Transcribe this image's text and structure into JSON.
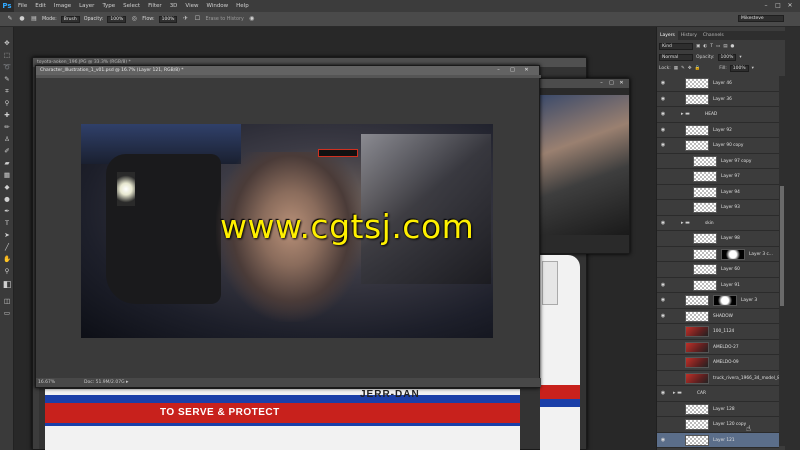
{
  "app": {
    "logo": "Ps"
  },
  "menu": [
    "File",
    "Edit",
    "Image",
    "Layer",
    "Type",
    "Select",
    "Filter",
    "3D",
    "View",
    "Window",
    "Help"
  ],
  "options_bar": {
    "mode_label": "Mode:",
    "mode_value": "Brush",
    "opacity_label": "Opacity:",
    "opacity_value": "100%",
    "flow_label": "Flow:",
    "flow_value": "100%",
    "erase_history_label": "Erase to History",
    "workspace": "Mikesteve"
  },
  "documents": {
    "back": {
      "title": "toyota-aoken_196.JPG @ 33.3% (RGB/8) *"
    },
    "front": {
      "title": "Character_Illustration_1_v01.psd @ 16.7% (Layer 121, RGB/8) *",
      "zoom": "16.67%",
      "doc_info": "Doc: 51.9M/2.07G"
    },
    "truck": {
      "brand": "JERR-DAN",
      "slogan": "TO SERVE & PROTECT"
    }
  },
  "layers_panel": {
    "tabs": [
      "Layers",
      "History",
      "Channels"
    ],
    "filter_kind": "Kind",
    "blend_mode": "Normal",
    "opacity_label": "Opacity:",
    "opacity_value": "100%",
    "lock_label": "Lock:",
    "fill_label": "Fill:",
    "fill_value": "100%",
    "layers": [
      {
        "name": "Layer 46",
        "indent": 1,
        "type": "layer",
        "visible": true
      },
      {
        "name": "Layer 36",
        "indent": 1,
        "type": "layer",
        "visible": true
      },
      {
        "name": "HEAD",
        "indent": 1,
        "type": "group",
        "visible": true
      },
      {
        "name": "Layer 92",
        "indent": 1,
        "type": "layer",
        "visible": true
      },
      {
        "name": "Layer 90 copy",
        "indent": 1,
        "type": "layer",
        "visible": true
      },
      {
        "name": "Layer 97 copy",
        "indent": 2,
        "type": "layer",
        "visible": false
      },
      {
        "name": "Layer 97",
        "indent": 2,
        "type": "layer",
        "visible": false
      },
      {
        "name": "Layer 94",
        "indent": 2,
        "type": "layer",
        "visible": false
      },
      {
        "name": "Layer 93",
        "indent": 2,
        "type": "layer",
        "visible": false
      },
      {
        "name": "skin",
        "indent": 1,
        "type": "group",
        "visible": true
      },
      {
        "name": "Layer 98",
        "indent": 2,
        "type": "layer",
        "visible": false
      },
      {
        "name": "Layer 3 c...",
        "indent": 2,
        "type": "masked",
        "visible": false
      },
      {
        "name": "Layer 60",
        "indent": 2,
        "type": "layer",
        "visible": false
      },
      {
        "name": "Layer 91",
        "indent": 2,
        "type": "layer",
        "visible": true
      },
      {
        "name": "Layer 3",
        "indent": 1,
        "type": "masked",
        "visible": true
      },
      {
        "name": "SHADOW",
        "indent": 1,
        "type": "layer",
        "visible": true
      },
      {
        "name": "100_1124",
        "indent": 1,
        "type": "photo",
        "visible": false
      },
      {
        "name": "AMELDO-27",
        "indent": 1,
        "type": "photo",
        "visible": false
      },
      {
        "name": "AMELDO-09",
        "indent": 1,
        "type": "photo",
        "visible": false
      },
      {
        "name": "truck_rivera_1966_34_model_84c_lh...",
        "indent": 1,
        "type": "photo",
        "visible": false
      },
      {
        "name": "CAR",
        "indent": 0,
        "type": "group",
        "visible": true
      },
      {
        "name": "Layer 128",
        "indent": 1,
        "type": "layer",
        "visible": false
      },
      {
        "name": "Layer 120 copy",
        "indent": 1,
        "type": "layer",
        "visible": false
      },
      {
        "name": "Layer 121",
        "indent": 1,
        "type": "layer",
        "visible": true,
        "selected": true
      }
    ]
  },
  "watermark": "www.cgtsj.com"
}
